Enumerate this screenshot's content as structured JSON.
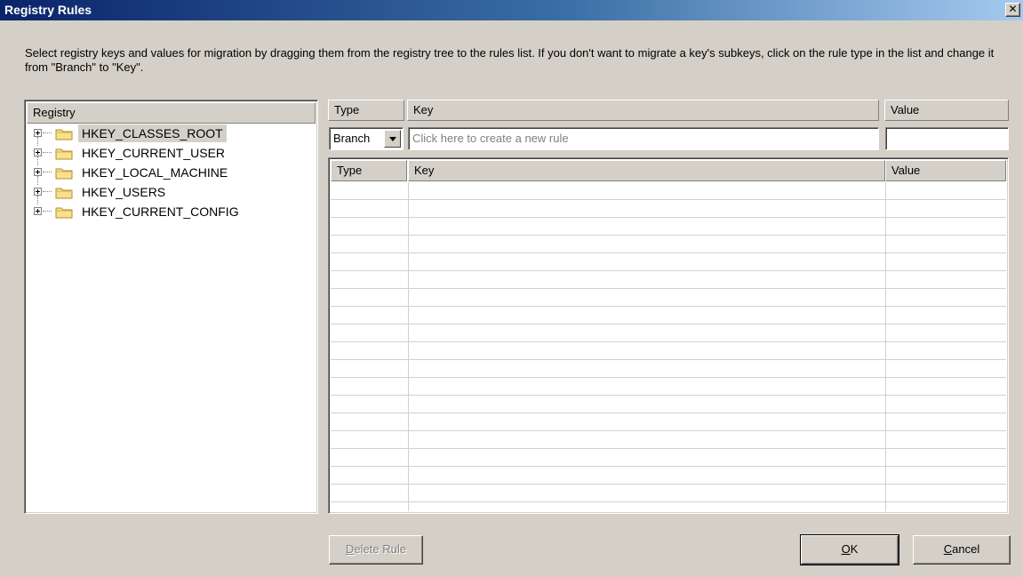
{
  "window": {
    "title": "Registry Rules"
  },
  "instructions": "Select registry keys and values for migration by dragging them from the registry tree to the rules list. If you don't want to migrate a key's subkeys, click on the rule type in the list and change it from \"Branch\" to \"Key\".",
  "tree": {
    "header": "Registry",
    "items": [
      {
        "label": "HKEY_CLASSES_ROOT",
        "selected": true
      },
      {
        "label": "HKEY_CURRENT_USER"
      },
      {
        "label": "HKEY_LOCAL_MACHINE"
      },
      {
        "label": "HKEY_USERS"
      },
      {
        "label": "HKEY_CURRENT_CONFIG"
      }
    ]
  },
  "new_rule": {
    "headers": {
      "type": "Type",
      "key": "Key",
      "value": "Value"
    },
    "type_value": "Branch",
    "key_placeholder": "Click here to create a new rule",
    "value_value": ""
  },
  "rules_list": {
    "headers": {
      "type": "Type",
      "key": "Key",
      "value": "Value"
    },
    "rows": []
  },
  "buttons": {
    "delete_rule": {
      "accel": "D",
      "rest": "elete Rule"
    },
    "ok": {
      "accel": "O",
      "rest": "K"
    },
    "cancel": {
      "accel": "C",
      "rest": "ancel"
    }
  },
  "colors": {
    "title_start": "#0a246a",
    "title_end": "#a6caf0",
    "face": "#d4d0c8"
  },
  "icons": [
    "close-icon",
    "folder-icon",
    "expand-plus-icon",
    "dropdown-arrow-icon"
  ]
}
